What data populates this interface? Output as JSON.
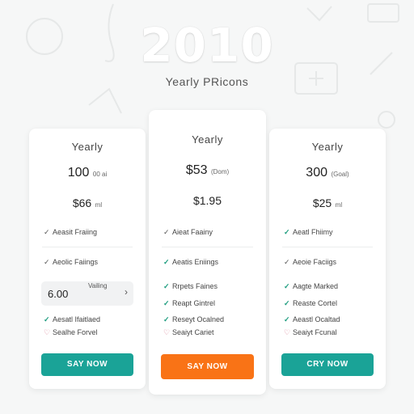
{
  "header": {
    "year": "2010",
    "subtitle": "Yearly PRicons"
  },
  "plans": {
    "left": {
      "title": "Yearly",
      "price_main": "100",
      "price_main_unit": "00 ai",
      "price_secondary": "$66",
      "price_secondary_unit": "ml",
      "feature_top_1": "Aeasit Fraiing",
      "feature_top_2": "Aeolic Faiings",
      "selector": {
        "value": "6.00",
        "label": "Vailing",
        "chevron": "›"
      },
      "feature_bottom_1": "Aesatl Ifaitlaed",
      "feature_bottom_2": "Sealhe Forvel",
      "cta": "SAY NOW"
    },
    "middle": {
      "title": "Yearly",
      "price_main": "$53",
      "price_main_unit": "(Dom)",
      "price_secondary": "$1.95",
      "feature_1": "Aieat Faainy",
      "feature_2": "Aeatis Eniings",
      "feature_3": "Rrpets Faines",
      "feature_4": "Reapt Gintrel",
      "feature_5": "Reseyt Ocalned",
      "feature_6": "Seaiyt Cariet",
      "cta": "SAY NOW"
    },
    "right": {
      "title": "Yearly",
      "price_main": "300",
      "price_main_unit": "(Goal)",
      "price_secondary": "$25",
      "price_secondary_unit": "ml",
      "feature_1": "Aeatl Fhiimy",
      "feature_2": "Aeoie Faciigs",
      "feature_3": "Aagte Marked",
      "feature_4": "Reaste Cortel",
      "feature_5": "Aeastl Ocaltad",
      "feature_6": "Seaiyt Fcunal",
      "cta": "CRY NOW"
    }
  },
  "colors": {
    "teal": "#1aa397",
    "orange": "#f97316",
    "check_green": "#1c9c7e",
    "check_pink": "#d67b8f"
  },
  "icons": {
    "check": "✓",
    "check_plain": "✓",
    "heart": "♡"
  }
}
